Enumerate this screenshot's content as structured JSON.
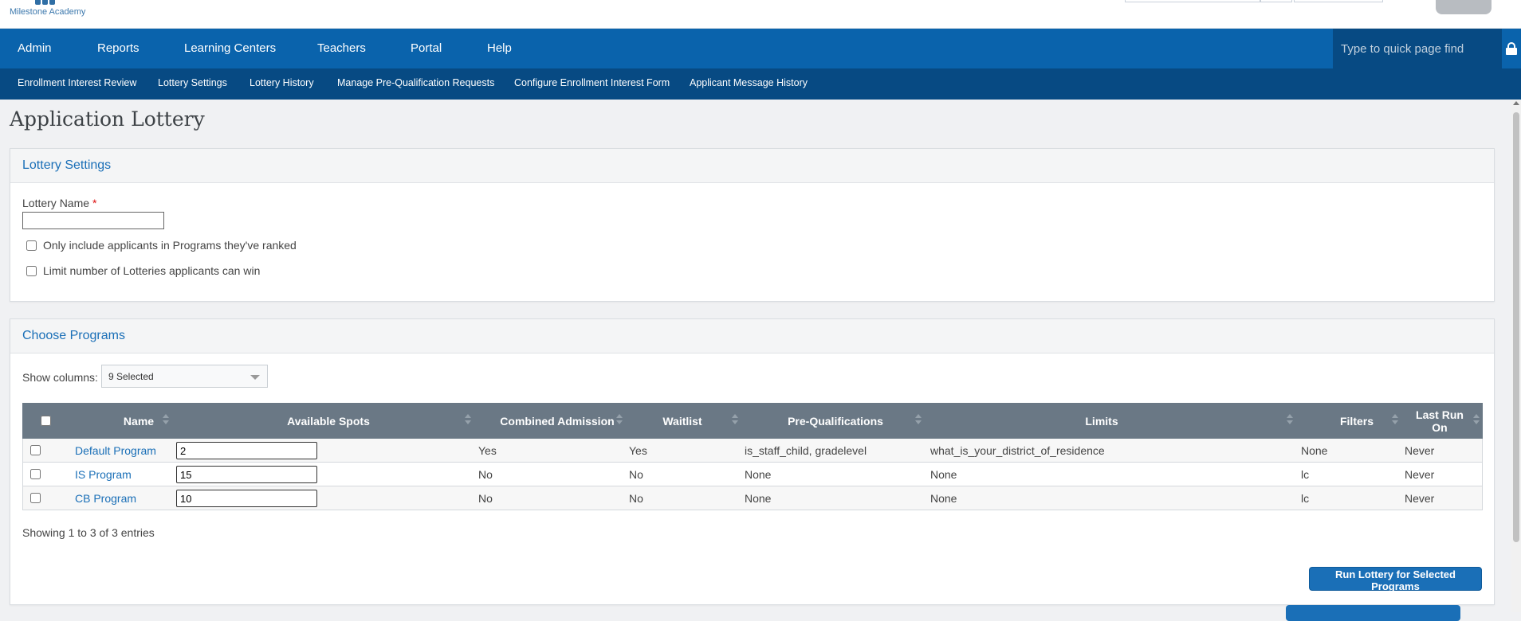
{
  "header": {
    "logo_text": "Milestone Academy"
  },
  "main_nav": {
    "items": [
      "Admin",
      "Reports",
      "Learning Centers",
      "Teachers",
      "Portal",
      "Help"
    ],
    "quick_find_placeholder": "Type to quick page find"
  },
  "sub_nav": {
    "items": [
      "Enrollment Interest Review",
      "Lottery Settings",
      "Lottery History",
      "Manage Pre-Qualification Requests",
      "Configure Enrollment Interest Form",
      "Applicant Message History"
    ]
  },
  "page": {
    "title": "Application Lottery"
  },
  "lottery_settings": {
    "title": "Lottery Settings",
    "name_label": "Lottery Name",
    "required_mark": "*",
    "name_value": "",
    "option_ranked": "Only include applicants in Programs they've ranked",
    "option_limit": "Limit number of Lotteries applicants can win"
  },
  "choose_programs": {
    "title": "Choose Programs",
    "show_columns_label": "Show columns:",
    "show_columns_value": "9 Selected",
    "columns": [
      "Name",
      "Available Spots",
      "Combined Admission",
      "Waitlist",
      "Pre-Qualifications",
      "Limits",
      "Filters",
      "Last Run On"
    ],
    "rows": [
      {
        "name": "Default Program",
        "spots": "2",
        "combined": "Yes",
        "waitlist": "Yes",
        "prequal": "is_staff_child, gradelevel",
        "limits": "what_is_your_district_of_residence",
        "filters": "None",
        "last_run": "Never"
      },
      {
        "name": "IS Program",
        "spots": "15",
        "combined": "No",
        "waitlist": "No",
        "prequal": "None",
        "limits": "None",
        "filters": "lc",
        "last_run": "Never"
      },
      {
        "name": "CB Program",
        "spots": "10",
        "combined": "No",
        "waitlist": "No",
        "prequal": "None",
        "limits": "None",
        "filters": "lc",
        "last_run": "Never"
      }
    ],
    "footer_info": "Showing 1 to 3 of 3 entries",
    "run_button": "Run Lottery for Selected Programs"
  }
}
